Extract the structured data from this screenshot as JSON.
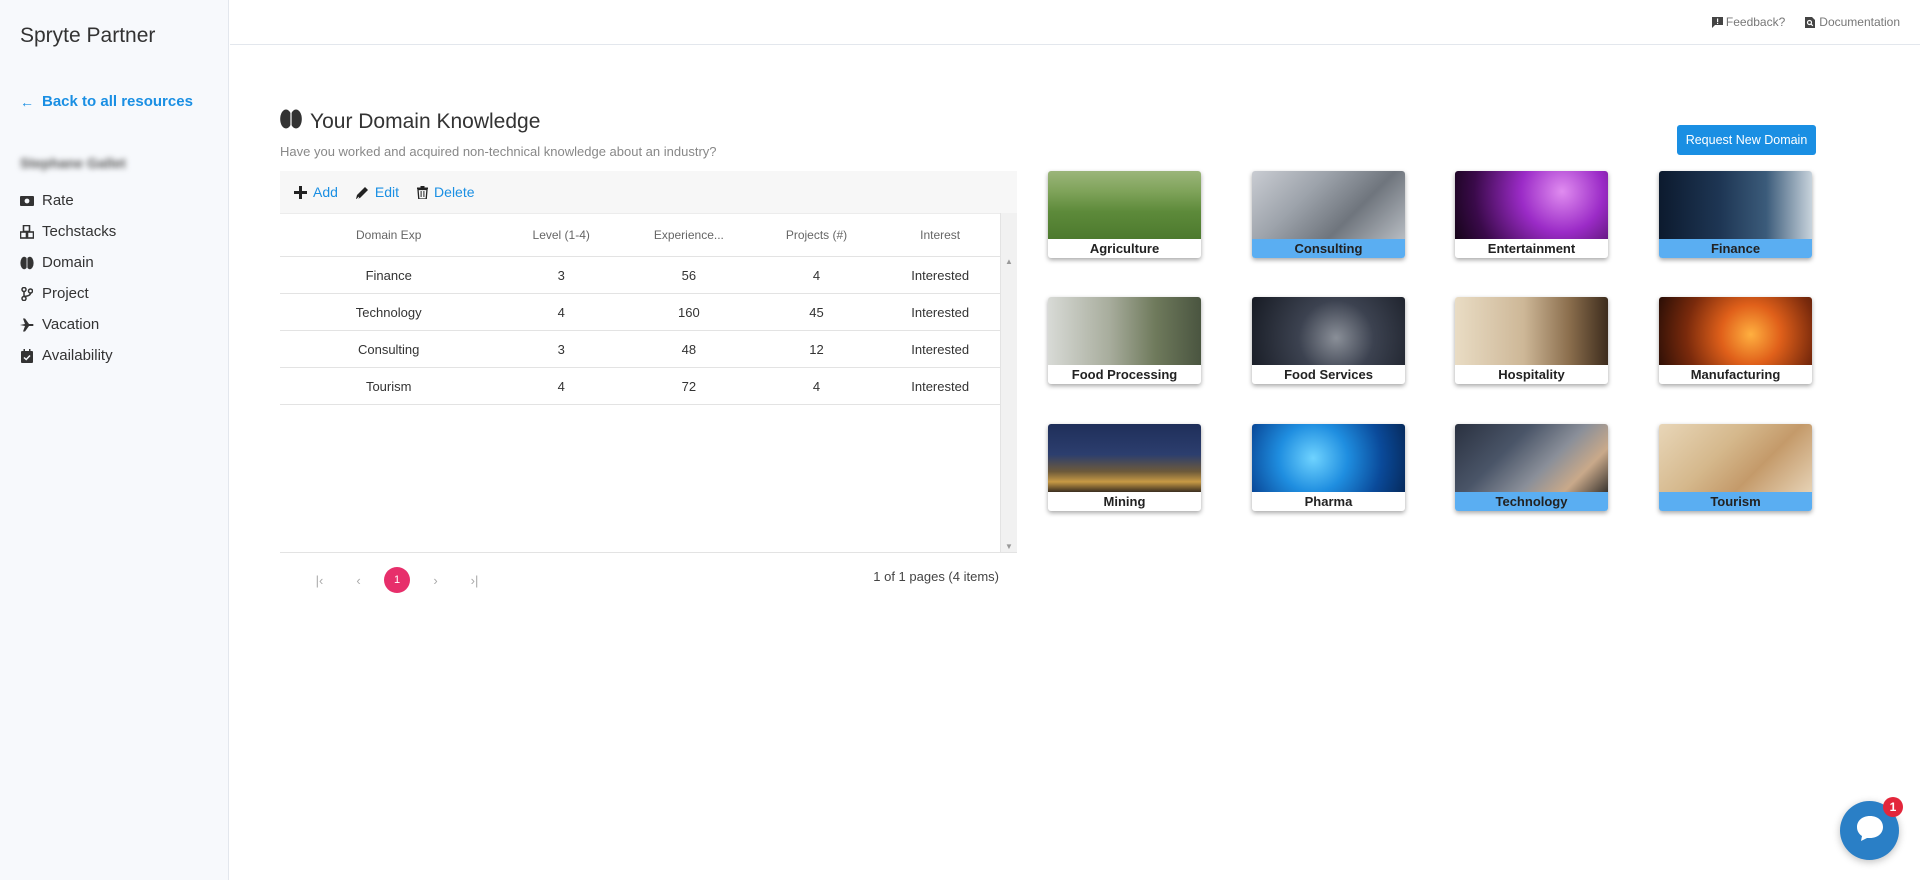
{
  "sidebar": {
    "app_title": "Spryte Partner",
    "back_label": "Back to all resources",
    "user_name": "Stephane Gallet",
    "items": [
      {
        "label": "Rate",
        "icon": "money-icon"
      },
      {
        "label": "Techstacks",
        "icon": "cubes-icon"
      },
      {
        "label": "Domain",
        "icon": "brain-icon"
      },
      {
        "label": "Project",
        "icon": "branch-icon"
      },
      {
        "label": "Vacation",
        "icon": "plane-icon"
      },
      {
        "label": "Availability",
        "icon": "calendar-check-icon"
      }
    ]
  },
  "topbar": {
    "feedback": "Feedback?",
    "documentation": "Documentation"
  },
  "section": {
    "title": "Your Domain Knowledge",
    "subtitle": "Have you worked and acquired non-technical knowledge about an industry?"
  },
  "toolbar": {
    "add": "Add",
    "edit": "Edit",
    "delete": "Delete"
  },
  "grid": {
    "columns": [
      "Domain Exp",
      "Level (1-4)",
      "Experience...",
      "Projects (#)",
      "Interest"
    ],
    "rows": [
      [
        "Finance",
        "3",
        "56",
        "4",
        "Interested"
      ],
      [
        "Technology",
        "4",
        "160",
        "45",
        "Interested"
      ],
      [
        "Consulting",
        "3",
        "48",
        "12",
        "Interested"
      ],
      [
        "Tourism",
        "4",
        "72",
        "4",
        "Interested"
      ]
    ]
  },
  "pager": {
    "current": "1",
    "info": "1 of 1 pages (4 items)"
  },
  "request_button": "Request New Domain",
  "domains": [
    {
      "label": "Agriculture",
      "selected": false
    },
    {
      "label": "Consulting",
      "selected": true
    },
    {
      "label": "Entertainment",
      "selected": false
    },
    {
      "label": "Finance",
      "selected": true
    },
    {
      "label": "Food Processing",
      "selected": false
    },
    {
      "label": "Food Services",
      "selected": false
    },
    {
      "label": "Hospitality",
      "selected": false
    },
    {
      "label": "Manufacturing",
      "selected": false
    },
    {
      "label": "Mining",
      "selected": false
    },
    {
      "label": "Pharma",
      "selected": false
    },
    {
      "label": "Technology",
      "selected": true
    },
    {
      "label": "Tourism",
      "selected": true
    }
  ],
  "chat_badge": "1",
  "colors": {
    "accent": "#1a8fe3",
    "pager_active": "#e72f6b",
    "selected_tile": "#5aaef2"
  }
}
